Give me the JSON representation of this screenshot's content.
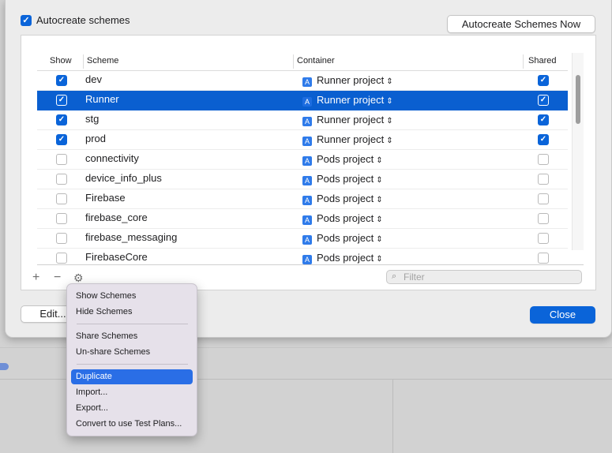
{
  "dialog": {
    "autocreate_label": "Autocreate schemes",
    "autocreate_now_button": "Autocreate Schemes Now",
    "edit_button": "Edit...",
    "close_button": "Close"
  },
  "table": {
    "headers": {
      "show": "Show",
      "scheme": "Scheme",
      "container": "Container",
      "shared": "Shared"
    },
    "rows": [
      {
        "show": true,
        "scheme": "dev",
        "container": "Runner project",
        "shared": true
      },
      {
        "show": true,
        "scheme": "Runner",
        "container": "Runner project",
        "shared": true,
        "selected": true
      },
      {
        "show": true,
        "scheme": "stg",
        "container": "Runner project",
        "shared": true
      },
      {
        "show": true,
        "scheme": "prod",
        "container": "Runner project",
        "shared": true
      },
      {
        "show": false,
        "scheme": "connectivity",
        "container": "Pods project",
        "shared": false
      },
      {
        "show": false,
        "scheme": "device_info_plus",
        "container": "Pods project",
        "shared": false
      },
      {
        "show": false,
        "scheme": "Firebase",
        "container": "Pods project",
        "shared": false
      },
      {
        "show": false,
        "scheme": "firebase_core",
        "container": "Pods project",
        "shared": false
      },
      {
        "show": false,
        "scheme": "firebase_messaging",
        "container": "Pods project",
        "shared": false
      },
      {
        "show": false,
        "scheme": "FirebaseCore",
        "container": "Pods project",
        "shared": false
      }
    ]
  },
  "toolbar": {
    "add": "+",
    "remove": "−",
    "gear": "⚙"
  },
  "filter": {
    "placeholder": "Filter"
  },
  "menu": {
    "items": [
      {
        "label": "Show Schemes"
      },
      {
        "label": "Hide Schemes"
      },
      {
        "label": "Share Schemes"
      },
      {
        "label": "Un-share Schemes"
      },
      {
        "label": "Duplicate",
        "highlighted": true
      },
      {
        "label": "Import..."
      },
      {
        "label": "Export..."
      },
      {
        "label": "Convert to use Test Plans..."
      }
    ]
  },
  "colors": {
    "accent": "#0a64d9",
    "selection": "#0a5fd0",
    "menu_highlight": "#2a6ee6"
  }
}
